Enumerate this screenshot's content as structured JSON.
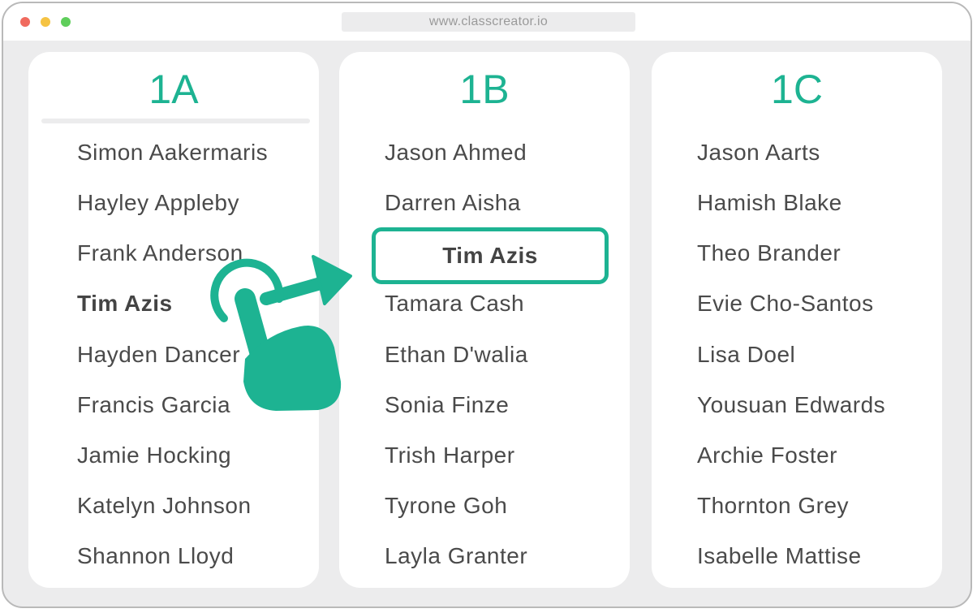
{
  "browser": {
    "url": "www.classcreator.io"
  },
  "classes": [
    {
      "title": "1A",
      "students": [
        "Simon Aakermaris",
        "Hayley Appleby",
        "Frank Anderson",
        "Tim Azis",
        "Hayden Dancer",
        "Francis Garcia",
        "Jamie Hocking",
        "Katelyn Johnson",
        "Shannon Lloyd"
      ]
    },
    {
      "title": "1B",
      "students": [
        "Jason Ahmed",
        "Darren Aisha",
        "Tamara Cash",
        "Ethan D'walia",
        "Sonia Finze",
        "Trish Harper",
        "Tyrone Goh",
        "Layla Granter"
      ],
      "dropped_student": "Tim Azis"
    },
    {
      "title": "1C",
      "students": [
        "Jason Aarts",
        "Hamish Blake",
        "Theo Brander",
        "Evie Cho-Santos",
        "Lisa Doel",
        "Yousuan Edwards",
        "Archie Foster",
        "Thornton Grey",
        "Isabelle Mattise"
      ]
    }
  ],
  "colors": {
    "accent": "#1db392",
    "background": "#ececed",
    "card": "#ffffff",
    "text": "#4a4a4a"
  },
  "icons": {
    "drag_hand": "hand-pointer-icon",
    "drag_arrow": "arrow-right-icon"
  }
}
